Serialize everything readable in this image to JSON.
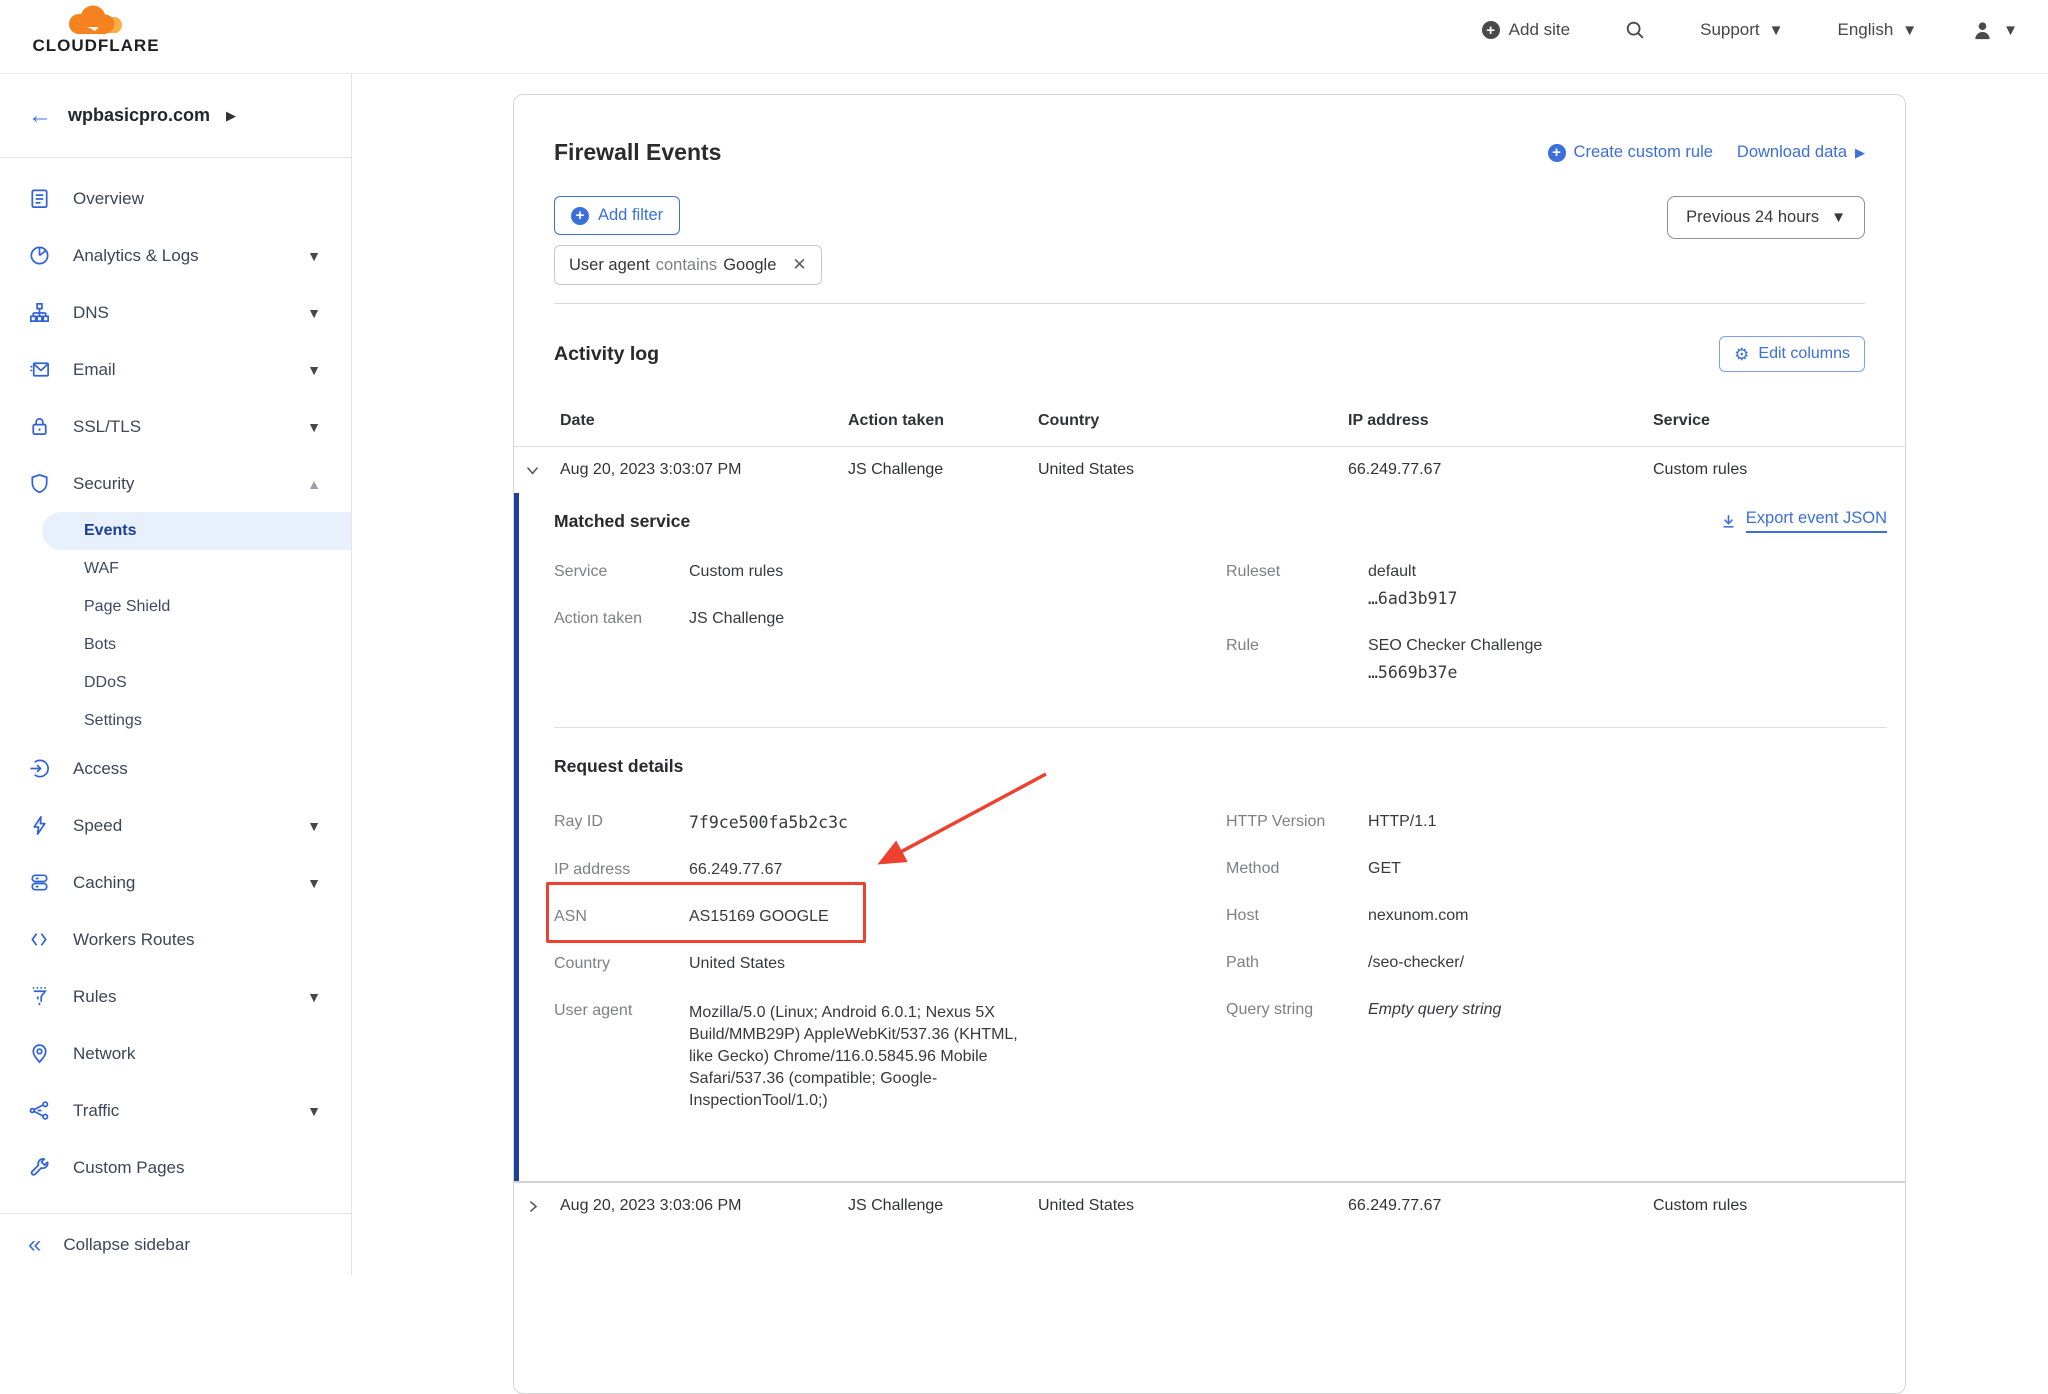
{
  "brand": {
    "name": "CLOUDFLARE"
  },
  "colors": {
    "accent_blue": "#3b6fd9",
    "nav_icon_blue": "#2f62d9",
    "active_item_bg": "#e7f0fb",
    "active_item_text": "#1d3d94",
    "annotation_red": "#ee4130",
    "expanded_bar_blue": "#1e3f99",
    "brand_orange": "#f6821f",
    "brand_orange_light": "#fbad41"
  },
  "header": {
    "add_site": "Add site",
    "support": "Support",
    "language": "English"
  },
  "sidebar": {
    "domain": "wpbasicpro.com",
    "items": [
      {
        "label": "Overview"
      },
      {
        "label": "Analytics & Logs"
      },
      {
        "label": "DNS"
      },
      {
        "label": "Email"
      },
      {
        "label": "SSL/TLS"
      },
      {
        "label": "Security"
      },
      {
        "label": "Access"
      },
      {
        "label": "Speed"
      },
      {
        "label": "Caching"
      },
      {
        "label": "Workers Routes"
      },
      {
        "label": "Rules"
      },
      {
        "label": "Network"
      },
      {
        "label": "Traffic"
      },
      {
        "label": "Custom Pages"
      }
    ],
    "security_subitems": [
      {
        "label": "Events"
      },
      {
        "label": "WAF"
      },
      {
        "label": "Page Shield"
      },
      {
        "label": "Bots"
      },
      {
        "label": "DDoS"
      },
      {
        "label": "Settings"
      }
    ],
    "collapse": "Collapse sidebar"
  },
  "page": {
    "title": "Firewall Events",
    "create_custom_rule": "Create custom rule",
    "download_data": "Download data",
    "add_filter": "Add filter",
    "filter_chip": {
      "field": "User agent",
      "operator": "contains",
      "value": "Google"
    },
    "time_range": "Previous 24 hours"
  },
  "activity_log": {
    "title": "Activity log",
    "edit_columns": "Edit columns",
    "columns": [
      "Date",
      "Action taken",
      "Country",
      "IP address",
      "Service"
    ],
    "rows": [
      {
        "date": "Aug 20, 2023 3:03:07 PM",
        "action": "JS Challenge",
        "country": "United States",
        "ip": "66.249.77.67",
        "service": "Custom rules"
      },
      {
        "date": "Aug 20, 2023 3:03:06 PM",
        "action": "JS Challenge",
        "country": "United States",
        "ip": "66.249.77.67",
        "service": "Custom rules"
      }
    ]
  },
  "event_detail": {
    "matched_service": {
      "title": "Matched service",
      "export_link": "Export event JSON",
      "service_label": "Service",
      "service_value": "Custom rules",
      "action_label": "Action taken",
      "action_value": "JS Challenge",
      "ruleset_label": "Ruleset",
      "ruleset_name": "default",
      "ruleset_id": "…6ad3b917",
      "rule_label": "Rule",
      "rule_name": "SEO Checker Challenge",
      "rule_id": "…5669b37e"
    },
    "request_details": {
      "title": "Request details",
      "ray_id_label": "Ray ID",
      "ray_id": "7f9ce500fa5b2c3c",
      "ip_label": "IP address",
      "ip": "66.249.77.67",
      "asn_label": "ASN",
      "asn": "AS15169 GOOGLE",
      "country_label": "Country",
      "country": "United States",
      "user_agent_label": "User agent",
      "user_agent": "Mozilla/5.0 (Linux; Android 6.0.1; Nexus 5X Build/MMB29P) AppleWebKit/537.36 (KHTML, like Gecko) Chrome/116.0.5845.96 Mobile Safari/537.36 (compatible; Google-InspectionTool/1.0;)",
      "http_version_label": "HTTP Version",
      "http_version": "HTTP/1.1",
      "method_label": "Method",
      "method": "GET",
      "host_label": "Host",
      "host": "nexunom.com",
      "path_label": "Path",
      "path": "/seo-checker/",
      "query_label": "Query string",
      "query": "Empty query string"
    }
  }
}
